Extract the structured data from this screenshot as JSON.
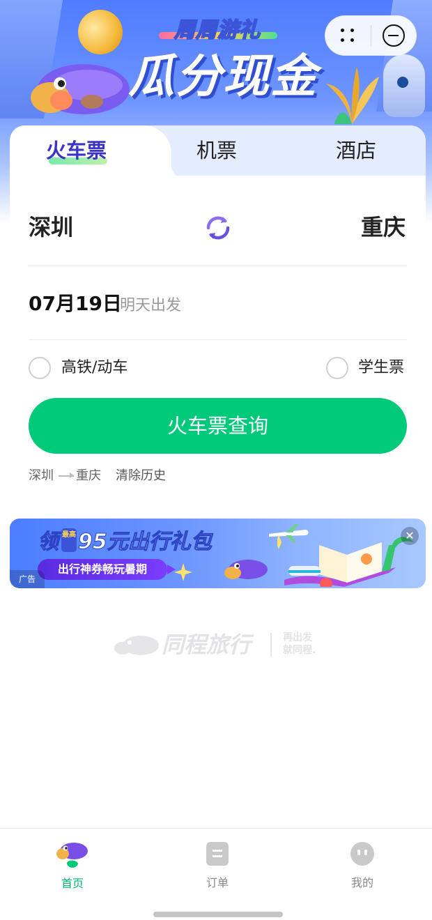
{
  "hero": {
    "subtitle": "周周游礼",
    "title": "瓜分现金"
  },
  "tabs": [
    {
      "label": "火车票",
      "active": true
    },
    {
      "label": "机票",
      "active": false
    },
    {
      "label": "酒店",
      "active": false
    }
  ],
  "search": {
    "from_city": "深圳",
    "to_city": "重庆",
    "date": "07月19日",
    "date_hint": "明天出发",
    "option_highspeed": "高铁/动车",
    "option_student": "学生票",
    "search_button": "火车票查询",
    "history_from": "深圳",
    "history_to": "重庆",
    "clear_history": "清除历史"
  },
  "ad": {
    "title_ling": "领",
    "title_tag": "最高",
    "title_main": "95元出行礼包",
    "subtitle": "出行神券畅玩暑期",
    "label": "广告",
    "close": "✕"
  },
  "brand": {
    "name": "同程旅行",
    "slogan_line1": "再出发",
    "slogan_line2": "就同程."
  },
  "nav": [
    {
      "label": "首页",
      "icon": "home-mascot-icon",
      "active": true
    },
    {
      "label": "订单",
      "icon": "order-icon",
      "active": false
    },
    {
      "label": "我的",
      "icon": "profile-icon",
      "active": false
    }
  ],
  "colors": {
    "accent_green": "#00c979",
    "tab_active": "#3a33c9",
    "hero_blue": "#4f7cff"
  }
}
